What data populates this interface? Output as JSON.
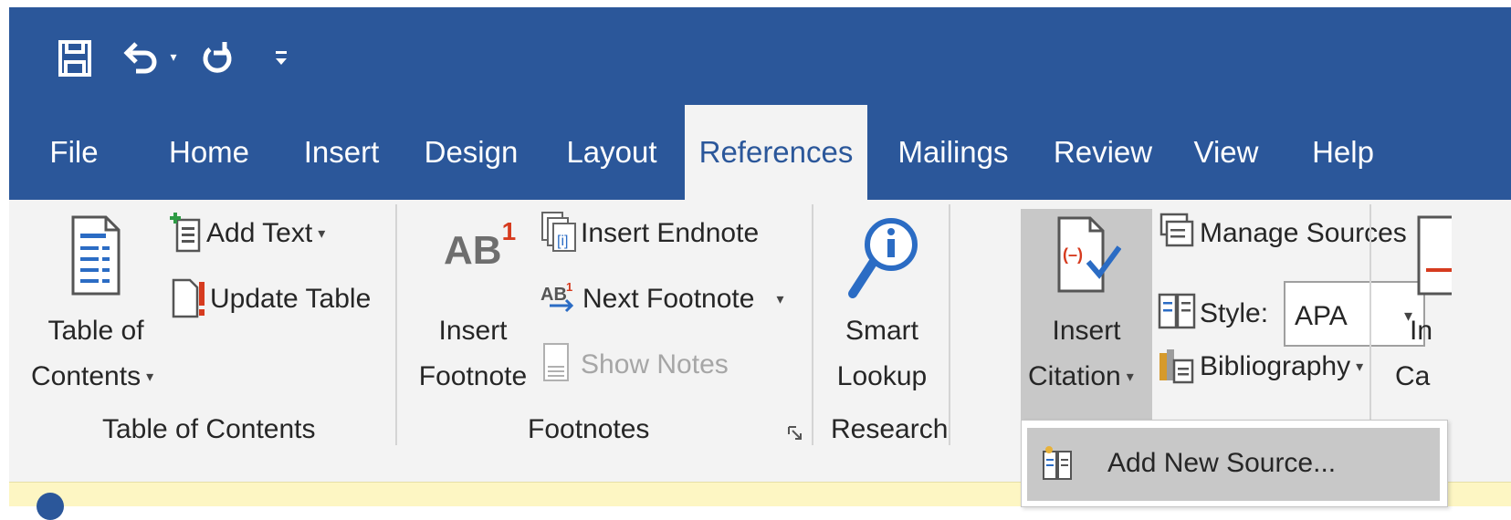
{
  "quick_access": {
    "save_icon": "save-icon",
    "undo_icon": "undo-icon",
    "redo_icon": "redo-icon",
    "customize_icon": "customize-qat-icon"
  },
  "tabs": [
    {
      "label": "File"
    },
    {
      "label": "Home"
    },
    {
      "label": "Insert"
    },
    {
      "label": "Design"
    },
    {
      "label": "Layout"
    },
    {
      "label": "References",
      "active": true
    },
    {
      "label": "Mailings"
    },
    {
      "label": "Review"
    },
    {
      "label": "View"
    },
    {
      "label": "Help"
    }
  ],
  "toc_group": {
    "table_of_contents_line1": "Table of",
    "table_of_contents_line2": "Contents",
    "add_text": "Add Text",
    "update_table": "Update Table",
    "label": "Table of Contents"
  },
  "footnotes_group": {
    "insert_footnote_line1": "Insert",
    "insert_footnote_line2": "Footnote",
    "footnote_icon_text": "AB",
    "footnote_icon_sup": "1",
    "insert_endnote": "Insert Endnote",
    "next_footnote": "Next Footnote",
    "show_notes": "Show Notes",
    "label": "Footnotes"
  },
  "research_group": {
    "smart_lookup_line1": "Smart",
    "smart_lookup_line2": "Lookup",
    "label": "Research"
  },
  "citations_group": {
    "insert_citation_line1": "Insert",
    "insert_citation_line2": "Citation",
    "manage_sources": "Manage Sources",
    "style_label": "Style:",
    "style_value": "APA",
    "bibliography": "Bibliography"
  },
  "captions_group": {
    "insert_caption_line1": "In",
    "insert_caption_line2": "Ca"
  },
  "citation_menu": {
    "add_new_source": "Add New Source..."
  },
  "colors": {
    "title_bar": "#2b579a",
    "ribbon": "#f3f3f3",
    "highlight": "#c8c8c8",
    "info_bar": "#fdf6c3"
  }
}
